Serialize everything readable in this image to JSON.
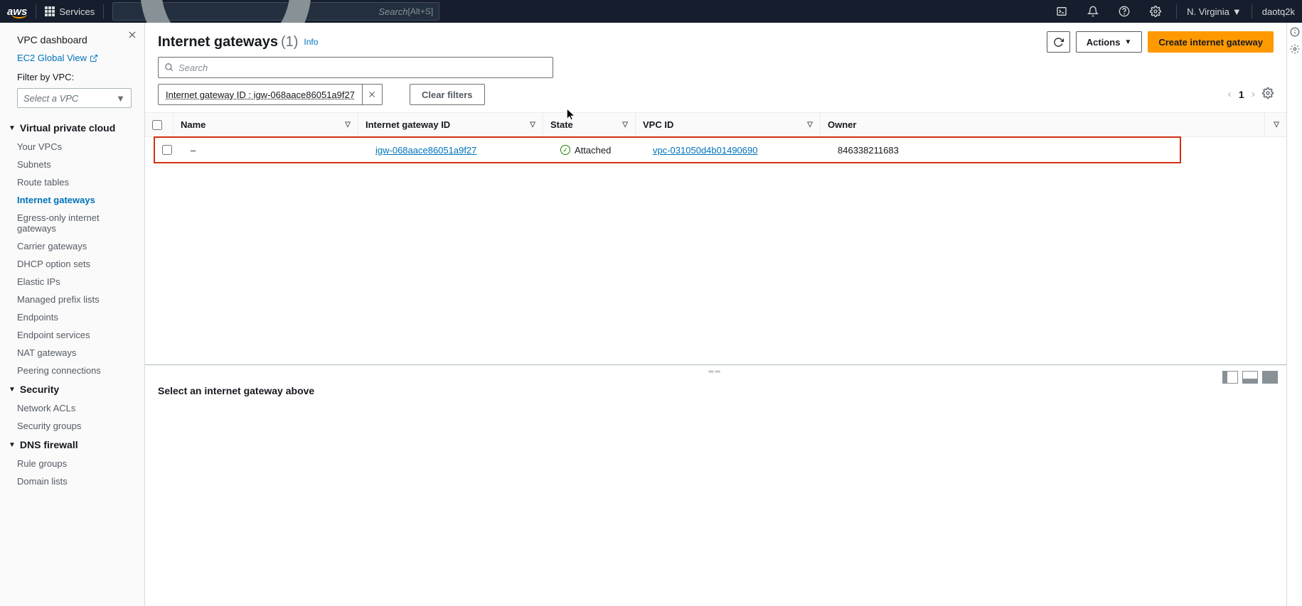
{
  "topnav": {
    "logo": "aws",
    "services": "Services",
    "search_placeholder": "Search",
    "shortcut": "[Alt+S]",
    "region": "N. Virginia",
    "user": "daotq2k"
  },
  "sidebar": {
    "dashboard": "VPC dashboard",
    "ec2_global": "EC2 Global View",
    "filter_label": "Filter by VPC:",
    "filter_placeholder": "Select a VPC",
    "sections": {
      "vpc": {
        "title": "Virtual private cloud",
        "items": [
          "Your VPCs",
          "Subnets",
          "Route tables",
          "Internet gateways",
          "Egress-only internet gateways",
          "Carrier gateways",
          "DHCP option sets",
          "Elastic IPs",
          "Managed prefix lists",
          "Endpoints",
          "Endpoint services",
          "NAT gateways",
          "Peering connections"
        ]
      },
      "security": {
        "title": "Security",
        "items": [
          "Network ACLs",
          "Security groups"
        ]
      },
      "dns": {
        "title": "DNS firewall",
        "items": [
          "Rule groups",
          "Domain lists"
        ]
      }
    }
  },
  "page": {
    "title": "Internet gateways",
    "count": "(1)",
    "info": "Info",
    "actions_btn": "Actions",
    "create_btn": "Create internet gateway",
    "search_placeholder": "Search",
    "filter_chip": "Internet gateway ID : igw-068aace86051a9f27",
    "clear_filters": "Clear filters",
    "page_num": "1"
  },
  "table": {
    "headers": {
      "name": "Name",
      "igw_id": "Internet gateway ID",
      "state": "State",
      "vpc_id": "VPC ID",
      "owner": "Owner"
    },
    "rows": [
      {
        "name": "–",
        "igw_id": "igw-068aace86051a9f27",
        "state": "Attached",
        "vpc_id": "vpc-031050d4b01490690",
        "owner": "846338211683"
      }
    ]
  },
  "details": {
    "empty_text": "Select an internet gateway above"
  }
}
